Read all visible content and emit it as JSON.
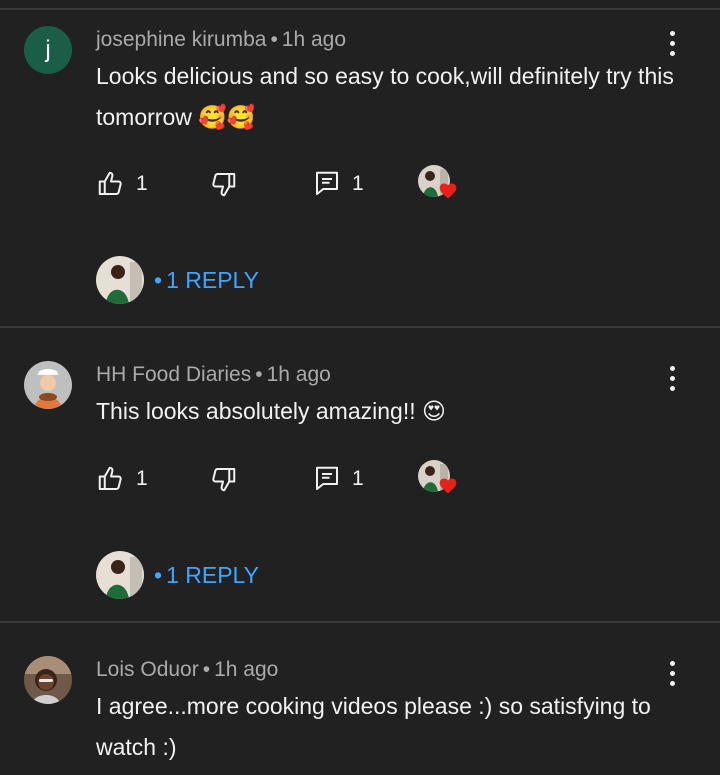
{
  "comments": [
    {
      "author": "josephine kirumba",
      "time": "1h ago",
      "separator": "•",
      "avatar_letter": "j",
      "text": "Looks delicious and so easy to cook,will definitely try this tomorrow 🥰🥰",
      "likes": "1",
      "replies_count": "1",
      "reply_link": "1 REPLY"
    },
    {
      "author": "HH Food Diaries",
      "time": "1h ago",
      "separator": "•",
      "text": "This looks absolutely amazing!! 😍",
      "likes": "1",
      "replies_count": "1",
      "reply_link": "1 REPLY"
    },
    {
      "author": "Lois Oduor",
      "time": "1h ago",
      "separator": "•",
      "text": "I agree...more cooking videos please :) so satisfying to watch :)"
    }
  ],
  "icons": {
    "like": "thumbs-up-icon",
    "dislike": "thumbs-down-icon",
    "reply": "comment-icon",
    "more": "more-vert-icon",
    "heart": "heart-icon"
  },
  "colors": {
    "background": "#212121",
    "link": "#3ea6ff",
    "heart": "#e62117",
    "meta": "#aaaaaa"
  }
}
